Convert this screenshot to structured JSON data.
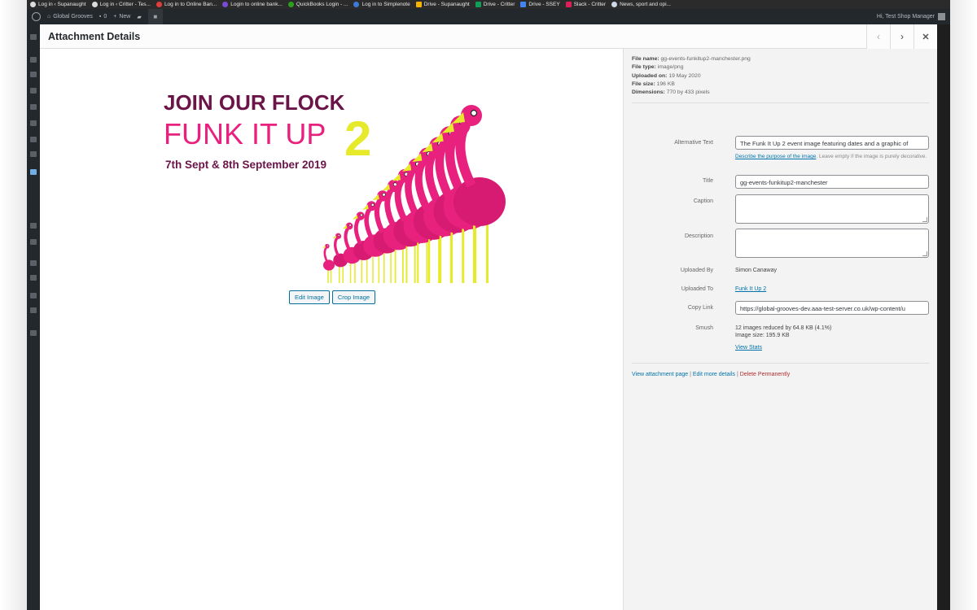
{
  "browser": {
    "bookmarks": [
      {
        "label": "Log in ‹ Supanaught",
        "icon": "wordpress-icon"
      },
      {
        "label": "Log in ‹ Critter - Tes...",
        "icon": "wordpress-icon"
      },
      {
        "label": "Log in to Online Ban...",
        "icon": "bank-icon"
      },
      {
        "label": "Login to online bank...",
        "icon": "bank-icon"
      },
      {
        "label": "QuickBooks Login - ...",
        "icon": "quickbooks-icon"
      },
      {
        "label": "Log in to Simplenote",
        "icon": "simplenote-icon"
      },
      {
        "label": "Drive - Supanaught",
        "icon": "drive-icon"
      },
      {
        "label": "Drive - Critter",
        "icon": "drive-icon"
      },
      {
        "label": "Drive - SSEY",
        "icon": "drive-icon"
      },
      {
        "label": "Slack - Critter",
        "icon": "slack-icon"
      },
      {
        "label": "News, sport and opi...",
        "icon": "guardian-icon"
      }
    ]
  },
  "admin_bar": {
    "site_name": "Global Grooves",
    "comments_count": "0",
    "new_label": "New",
    "greeting": "Hi, Test Shop Manager"
  },
  "modal": {
    "title": "Attachment Details",
    "prev_icon": "chevron-left-icon",
    "next_icon": "chevron-right-icon",
    "close_icon": "close-icon"
  },
  "preview": {
    "artwork": {
      "line1": "JOIN OUR FLOCK",
      "line2": "FUNK IT UP",
      "number": "2",
      "line3": "7th Sept & 8th September 2019",
      "colors": {
        "purple": "#6b1447",
        "pink": "#e8217f",
        "yellow": "#e6ea2a"
      }
    },
    "edit_image_label": "Edit Image",
    "crop_image_label": "Crop Image"
  },
  "details": {
    "file_name_label": "File name:",
    "file_name": "gg-events-funkitup2-manchester.png",
    "file_type_label": "File type:",
    "file_type": "image/png",
    "uploaded_on_label": "Uploaded on:",
    "uploaded_on": "19 May 2020",
    "file_size_label": "File size:",
    "file_size": "196 KB",
    "dimensions_label": "Dimensions:",
    "dimensions": "770 by 433 pixels",
    "alt_text_label": "Alternative Text",
    "alt_text_value": "The Funk It Up 2 event image featuring dates and a graphic of",
    "alt_help_link": "Describe the purpose of the image",
    "alt_help_text": ". Leave empty if the image is purely decorative.",
    "title_label": "Title",
    "title_value": "gg-events-funkitup2-manchester",
    "caption_label": "Caption",
    "description_label": "Description",
    "uploaded_by_label": "Uploaded By",
    "uploaded_by_value": "Simon Canaway",
    "uploaded_to_label": "Uploaded To",
    "uploaded_to_value": "Funk It Up 2",
    "copy_link_label": "Copy Link",
    "copy_link_value": "https://global-grooves-dev.aaa-test-server.co.uk/wp-content/u",
    "smush_label": "Smush",
    "smush_line1": "12 images reduced by 64.8 KB (4.1%)",
    "smush_line2": "Image size: 195.9 KB",
    "smush_link": "View Stats",
    "view_attachment": "View attachment page",
    "sep": " | ",
    "edit_more": "Edit more details",
    "delete": "Delete Permanently"
  }
}
